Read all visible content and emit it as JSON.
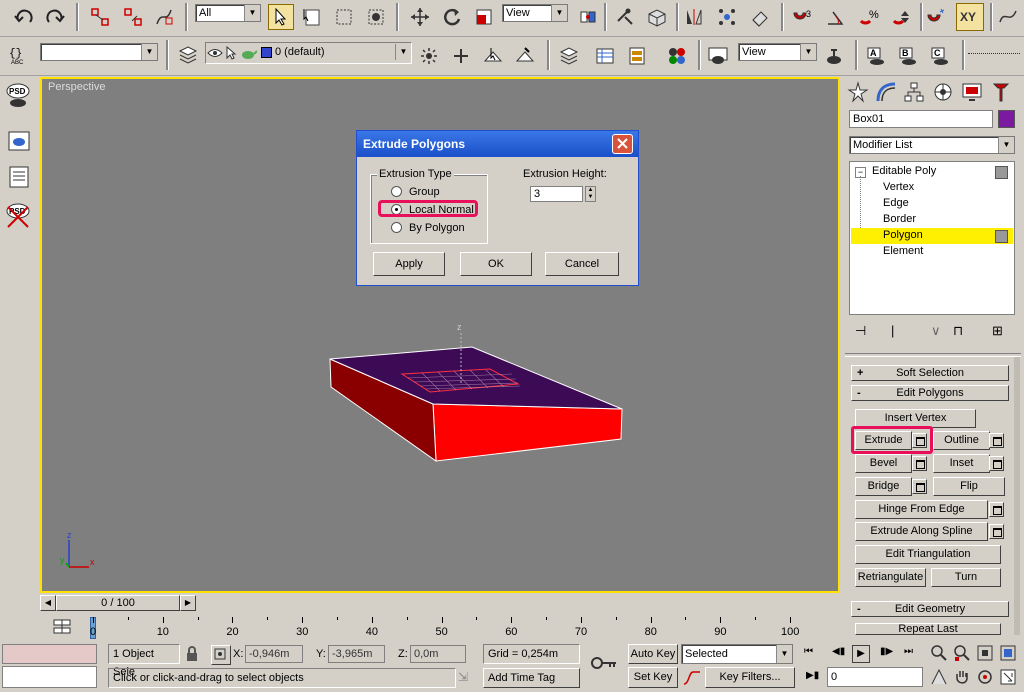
{
  "toolbar1": {
    "filter_value": "All",
    "refcoord_value": "View"
  },
  "toolbar2": {
    "named_sel_value": "",
    "layer_value": "0 (default)",
    "render_view_value": "View"
  },
  "viewport": {
    "label": "Perspective",
    "gizmo_label": "z",
    "axis_z": "z",
    "axis_y": "y",
    "axis_x": "x"
  },
  "left_panel": {
    "psd_label": "PSD",
    "psd2_label": "PSD"
  },
  "dialog": {
    "title": "Extrude Polygons",
    "group_label": "Extrusion Type",
    "options": [
      "Group",
      "Local Normal",
      "By Polygon"
    ],
    "selected_option": "Local Normal",
    "height_label": "Extrusion Height:",
    "height_value": "3",
    "apply_label": "Apply",
    "ok_label": "OK",
    "cancel_label": "Cancel"
  },
  "right_panel": {
    "object_name": "Box01",
    "object_color": "#7b1aa0",
    "modifier_list_label": "Modifier List",
    "stack_root": "Editable Poly",
    "stack_items": [
      "Vertex",
      "Edge",
      "Border",
      "Polygon",
      "Element"
    ],
    "stack_selected": "Polygon",
    "soft_selection_label": "Soft Selection",
    "soft_sign": "+",
    "edit_polygons_label": "Edit Polygons",
    "edit_sign": "-",
    "insert_vertex": "Insert Vertex",
    "extrude": "Extrude",
    "outline": "Outline",
    "bevel": "Bevel",
    "inset": "Inset",
    "bridge": "Bridge",
    "flip": "Flip",
    "hinge": "Hinge From Edge",
    "extrude_spline": "Extrude Along Spline",
    "edit_tri": "Edit Triangulation",
    "retriangulate": "Retriangulate",
    "turn": "Turn",
    "edit_geometry_label": "Edit Geometry",
    "geo_sign": "-",
    "repeat_last": "Repeat Last"
  },
  "timeline": {
    "frame_label": "0 / 100",
    "ticks": [
      "0",
      "10",
      "20",
      "30",
      "40",
      "50",
      "60",
      "70",
      "80",
      "90",
      "100"
    ]
  },
  "status": {
    "selection_text": "1 Object Sele",
    "x_label": "X:",
    "x_value": "-0,946m",
    "y_label": "Y:",
    "y_value": "-3,965m",
    "z_label": "Z:",
    "z_value": "0,0m",
    "grid_text": "Grid = 0,254m",
    "prompt_text": "Click or click-and-drag to select objects",
    "add_time_tag": "Add Time Tag",
    "auto_key": "Auto Key",
    "set_key": "Set Key",
    "selected_value": "Selected",
    "key_filters": "Key Filters...",
    "frame_value": "0"
  },
  "highlight_color": "#e8105a",
  "object_colors": {
    "top": "#3d0a55",
    "side": "#ff0000",
    "side_dark": "#8a0000"
  }
}
